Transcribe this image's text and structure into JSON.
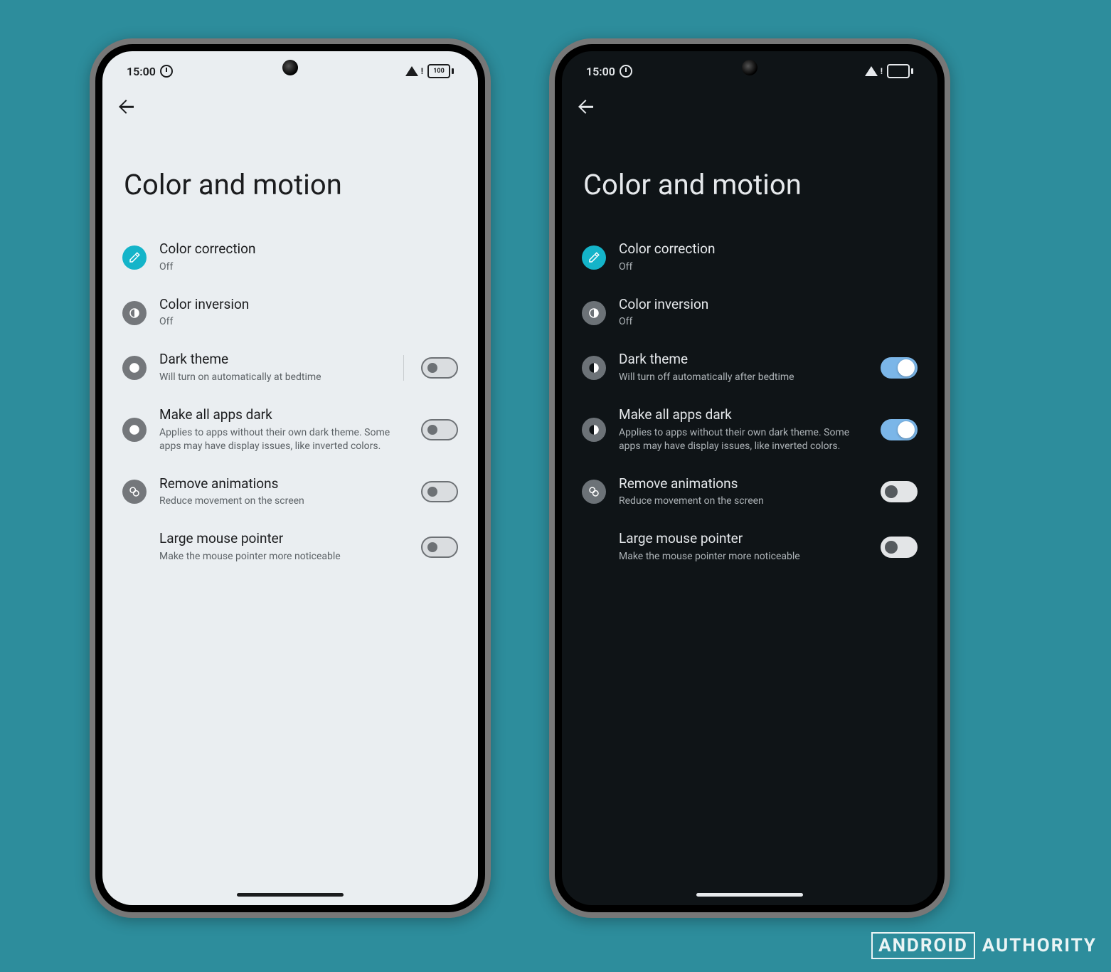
{
  "status": {
    "time": "15:00",
    "battery": "100"
  },
  "page_title": "Color and motion",
  "light": {
    "color_correction": {
      "title": "Color correction",
      "status": "Off"
    },
    "color_inversion": {
      "title": "Color inversion",
      "status": "Off"
    },
    "dark_theme": {
      "title": "Dark theme",
      "subtitle": "Will turn on automatically at bedtime",
      "on": false
    },
    "make_all_dark": {
      "title": "Make all apps dark",
      "subtitle": "Applies to apps without their own dark theme. Some apps may have display issues, like inverted colors.",
      "on": false
    },
    "remove_anim": {
      "title": "Remove animations",
      "subtitle": "Reduce movement on the screen",
      "on": false
    },
    "large_pointer": {
      "title": "Large mouse pointer",
      "subtitle": "Make the mouse pointer more noticeable",
      "on": false
    }
  },
  "dark": {
    "color_correction": {
      "title": "Color correction",
      "status": "Off"
    },
    "color_inversion": {
      "title": "Color inversion",
      "status": "Off"
    },
    "dark_theme": {
      "title": "Dark theme",
      "subtitle": "Will turn off automatically after bedtime",
      "on": true
    },
    "make_all_dark": {
      "title": "Make all apps dark",
      "subtitle": "Applies to apps without their own dark theme. Some apps may have display issues, like inverted colors.",
      "on": true
    },
    "remove_anim": {
      "title": "Remove animations",
      "subtitle": "Reduce movement on the screen",
      "on": false
    },
    "large_pointer": {
      "title": "Large mouse pointer",
      "subtitle": "Make the mouse pointer more noticeable",
      "on": false
    }
  },
  "watermark": {
    "left": "ANDROID",
    "right": "AUTHORITY"
  }
}
